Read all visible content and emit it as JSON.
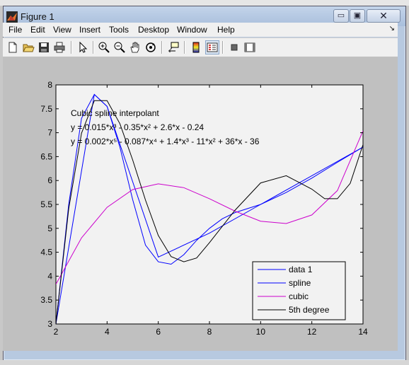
{
  "window": {
    "title": "Figure 1",
    "minimize_glyph": "▭",
    "restore_glyph": "▣",
    "close_glyph": "✕"
  },
  "menu": [
    "File",
    "Edit",
    "View",
    "Insert",
    "Tools",
    "Desktop",
    "Window",
    "Help"
  ],
  "menu_arrow": "↘",
  "toolbar": [
    "new-file-icon",
    "open-folder-icon",
    "save-icon",
    "print-icon",
    "pointer-icon",
    "zoom-in-icon",
    "zoom-out-icon",
    "pan-icon",
    "rotate-3d-icon",
    "data-cursor-icon",
    "colorbar-icon",
    "legend-icon",
    "hide-plot-tools-icon",
    "show-plot-tools-icon"
  ],
  "annotations": {
    "line1": "Cubic spline interpolant",
    "line2": "y = 0.015*x³ - 0.35*x² + 2.6*x - 0.24",
    "line3": "y = 0.002*x⁵ - 0.087*x⁴ + 1.4*x³ - 11*x² + 36*x - 36"
  },
  "chart_data": {
    "type": "line",
    "title": "",
    "xlabel": "",
    "ylabel": "",
    "xlim": [
      2,
      14
    ],
    "ylim": [
      3,
      8
    ],
    "xticks": [
      2,
      4,
      6,
      8,
      10,
      12,
      14
    ],
    "yticks": [
      3,
      3.5,
      4,
      4.5,
      5,
      5.5,
      6,
      6.5,
      7,
      7.5,
      8
    ],
    "grid": false,
    "legend_position": "bottom-right",
    "series": [
      {
        "name": "data 1",
        "color": "#0000ff",
        "x": [
          2,
          3.5,
          4,
          6,
          8,
          10,
          14
        ],
        "y": [
          3.0,
          7.8,
          7.55,
          4.4,
          4.9,
          5.5,
          6.7
        ]
      },
      {
        "name": "spline",
        "color": "#0000ff",
        "x": [
          2,
          2.5,
          3,
          3.5,
          4,
          4.5,
          5,
          5.5,
          6,
          6.5,
          7,
          7.5,
          8,
          8.5,
          9,
          10,
          11,
          12,
          13,
          14
        ],
        "y": [
          3.0,
          5.5,
          7.3,
          7.8,
          7.55,
          6.7,
          5.6,
          4.65,
          4.3,
          4.25,
          4.45,
          4.75,
          5.0,
          5.2,
          5.33,
          5.5,
          5.75,
          6.05,
          6.38,
          6.7
        ]
      },
      {
        "name": "cubic",
        "color": "#cc00cc",
        "x": [
          2,
          3,
          4,
          5,
          6,
          7,
          8,
          9,
          10,
          11,
          12,
          13,
          14
        ],
        "y": [
          3.83,
          4.8,
          5.44,
          5.81,
          5.93,
          5.85,
          5.62,
          5.36,
          5.15,
          5.1,
          5.28,
          5.79,
          7.04
        ]
      },
      {
        "name": "5th degree",
        "color": "#000000",
        "x": [
          2,
          2.5,
          3,
          3.5,
          4,
          4.5,
          5,
          5.5,
          6,
          6.5,
          7,
          7.5,
          8,
          9,
          10,
          11,
          12,
          12.5,
          13,
          13.5,
          14
        ],
        "y": [
          3.0,
          5.41,
          6.99,
          7.67,
          7.67,
          7.19,
          6.43,
          5.59,
          4.85,
          4.41,
          4.3,
          4.38,
          4.7,
          5.38,
          5.95,
          6.1,
          5.82,
          5.62,
          5.62,
          5.94,
          6.75
        ]
      }
    ]
  }
}
